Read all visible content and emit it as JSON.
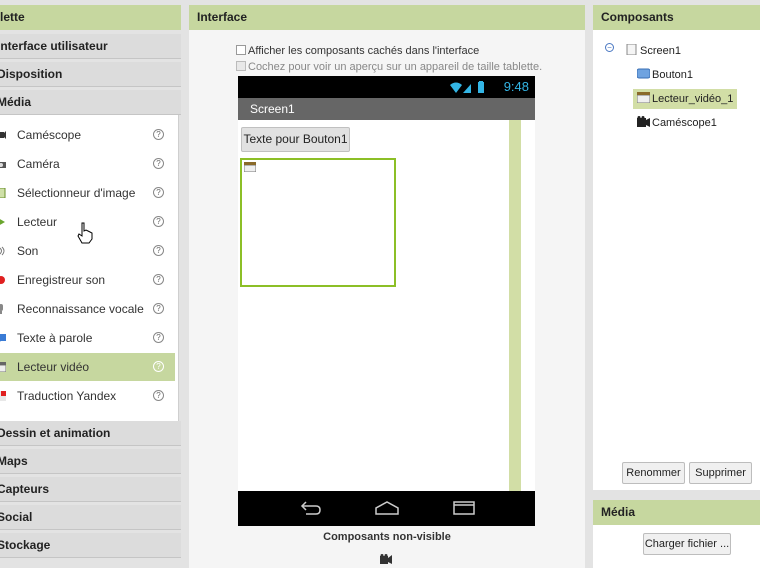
{
  "palette": {
    "header": "lette",
    "categories_top": [
      "Interface utilisateur",
      "Disposition",
      "Média"
    ],
    "items": [
      {
        "label": "Caméscope",
        "icon": "camcorder-icon"
      },
      {
        "label": "Caméra",
        "icon": "camera-icon"
      },
      {
        "label": "Sélectionneur d'image",
        "icon": "image-picker-icon"
      },
      {
        "label": "Lecteur",
        "icon": "player-icon"
      },
      {
        "label": "Son",
        "icon": "sound-icon"
      },
      {
        "label": "Enregistreur son",
        "icon": "sound-recorder-icon"
      },
      {
        "label": "Reconnaissance vocale",
        "icon": "speech-recognizer-icon"
      },
      {
        "label": "Texte à parole",
        "icon": "text-to-speech-icon"
      },
      {
        "label": "Lecteur vidéo",
        "icon": "video-player-icon",
        "selected": true
      },
      {
        "label": "Traduction Yandex",
        "icon": "yandex-translate-icon"
      }
    ],
    "help_glyph": "?",
    "categories_bottom": [
      "Dessin et animation",
      "Maps",
      "Capteurs",
      "Social",
      "Stockage"
    ]
  },
  "interface": {
    "header": "Interface",
    "show_hidden_label": "Afficher les composants cachés dans l'interface",
    "tablet_preview_label": "Cochez pour voir un aperçu sur un appareil de taille tablette.",
    "status_time": "9:48",
    "screen_title": "Screen1",
    "button_text": "Texte pour Bouton1",
    "nonvisible_label": "Composants non-visible"
  },
  "components": {
    "header": "Composants",
    "tree": [
      {
        "label": "Screen1",
        "icon": "screen-icon"
      },
      {
        "label": "Bouton1",
        "icon": "button-icon"
      },
      {
        "label": "Lecteur_vidéo_1",
        "icon": "video-player-icon",
        "selected": true
      },
      {
        "label": "Caméscope1",
        "icon": "camcorder-icon"
      }
    ],
    "rename_label": "Renommer",
    "delete_label": "Supprimer"
  },
  "media": {
    "header": "Média",
    "upload_label": "Charger fichier ..."
  },
  "colors": {
    "accent_green": "#c6d79f",
    "selection_green": "#d2dea6",
    "video_border": "#8cbf26",
    "status_blue": "#33b5e5"
  }
}
